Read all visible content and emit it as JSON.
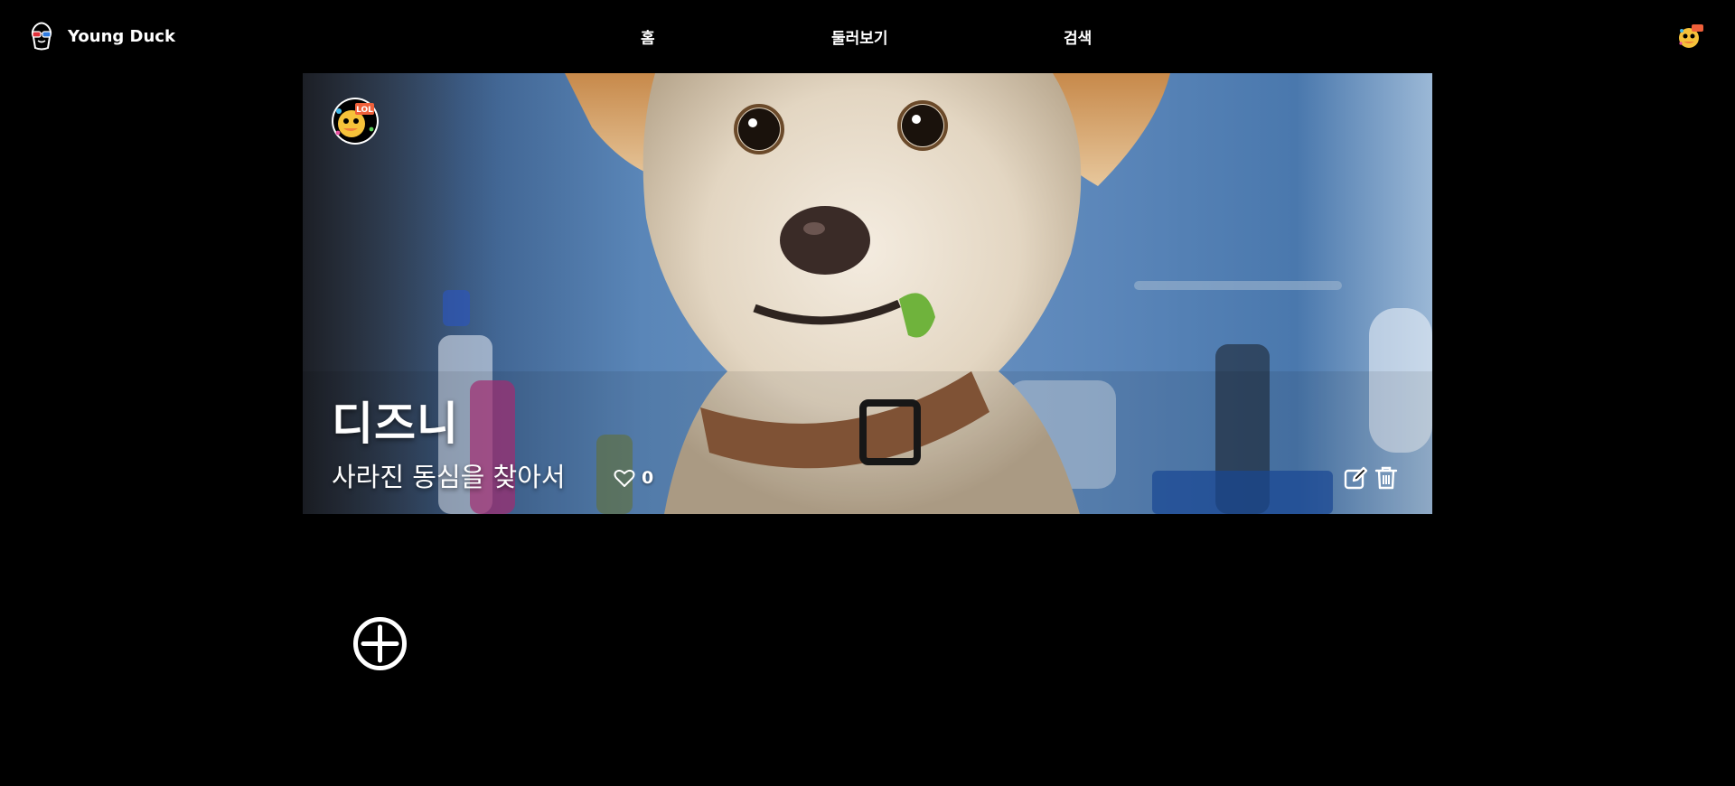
{
  "header": {
    "brand_name": "Young Duck",
    "nav": {
      "home": "홈",
      "explore": "둘러보기",
      "search": "검색"
    },
    "avatar_icon": "duck-avatar-icon"
  },
  "banner": {
    "title": "디즈니",
    "subtitle": "사라진 동심을 찾아서",
    "likes": "0",
    "avatar_badge": "LOL",
    "photo": "dog-with-collar-photo"
  },
  "actions": {
    "edit_icon": "edit-icon",
    "delete_icon": "trash-icon",
    "add_icon": "plus-circle-icon"
  },
  "colors": {
    "background": "#000000",
    "text": "#ffffff",
    "avatar_yellow": "#f6c23a",
    "avatar_badge": "#f0603a"
  }
}
